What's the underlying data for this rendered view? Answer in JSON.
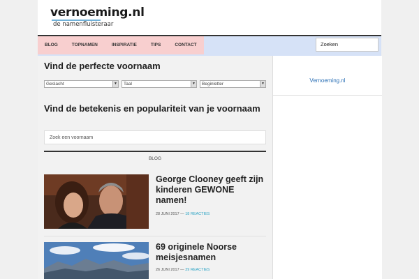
{
  "logo": {
    "name": "vernoeming.nl",
    "tagline": "de namenfluisteraar"
  },
  "nav": {
    "items": [
      "BLOG",
      "TOPNAMEN",
      "INSPIRATIE",
      "TIPS",
      "CONTACT"
    ],
    "search_placeholder": "Zoeken"
  },
  "sidebar": {
    "ad_label": "Vernoeming.nl"
  },
  "section1": {
    "title": "Vind de perfecte voornaam",
    "filters": [
      {
        "label": "Geslacht"
      },
      {
        "label": "Taal"
      },
      {
        "label": "Beginletter"
      }
    ]
  },
  "section2": {
    "title": "Vind de betekenis en populariteit van je voornaam",
    "input_placeholder": "Zoek een voornaam"
  },
  "blog": {
    "label": "BLOG"
  },
  "posts": [
    {
      "title": "George Clooney geeft zijn kinderen GEWONE namen!",
      "date": "28 JUNI 2017",
      "comments": "18 REACTIES"
    },
    {
      "title": "69 originele Noorse meisjesnamen",
      "date": "26 JUNI 2017",
      "comments": "29 REACTIES"
    }
  ],
  "colors": {
    "menu_bg": "#f8cfcf",
    "nav_bg": "#d6e2f7",
    "accent": "#2ba3c4"
  }
}
